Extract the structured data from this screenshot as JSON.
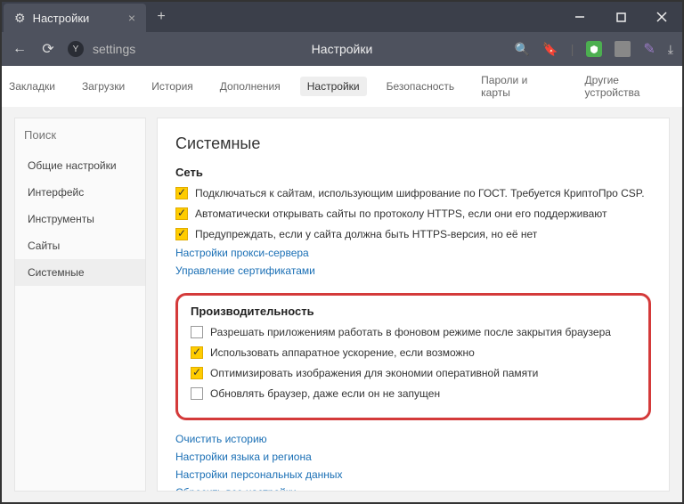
{
  "tab": {
    "title": "Настройки"
  },
  "address": {
    "url": "settings",
    "pageTitle": "Настройки"
  },
  "topnav": {
    "items": [
      "Закладки",
      "Загрузки",
      "История",
      "Дополнения",
      "Настройки",
      "Безопасность",
      "Пароли и карты",
      "Другие устройства"
    ],
    "activeIndex": 4
  },
  "sidebar": {
    "searchPlaceholder": "Поиск",
    "items": [
      "Общие настройки",
      "Интерфейс",
      "Инструменты",
      "Сайты",
      "Системные"
    ],
    "activeIndex": 4
  },
  "content": {
    "heading": "Системные",
    "network": {
      "title": "Сеть",
      "checks": [
        {
          "on": true,
          "label": "Подключаться к сайтам, использующим шифрование по ГОСТ. Требуется КриптоПро CSP."
        },
        {
          "on": true,
          "label": "Автоматически открывать сайты по протоколу HTTPS, если они его поддерживают"
        },
        {
          "on": true,
          "label": "Предупреждать, если у сайта должна быть HTTPS-версия, но её нет"
        }
      ],
      "links": [
        "Настройки прокси-сервера",
        "Управление сертификатами"
      ]
    },
    "performance": {
      "title": "Производительность",
      "checks": [
        {
          "on": false,
          "label": "Разрешать приложениям работать в фоновом режиме после закрытия браузера"
        },
        {
          "on": true,
          "label": "Использовать аппаратное ускорение, если возможно"
        },
        {
          "on": true,
          "label": "Оптимизировать изображения для экономии оперативной памяти"
        },
        {
          "on": false,
          "label": "Обновлять браузер, даже если он не запущен"
        }
      ]
    },
    "bottomLinks": [
      "Очистить историю",
      "Настройки языка и региона",
      "Настройки персональных данных",
      "Сбросить все настройки"
    ]
  }
}
